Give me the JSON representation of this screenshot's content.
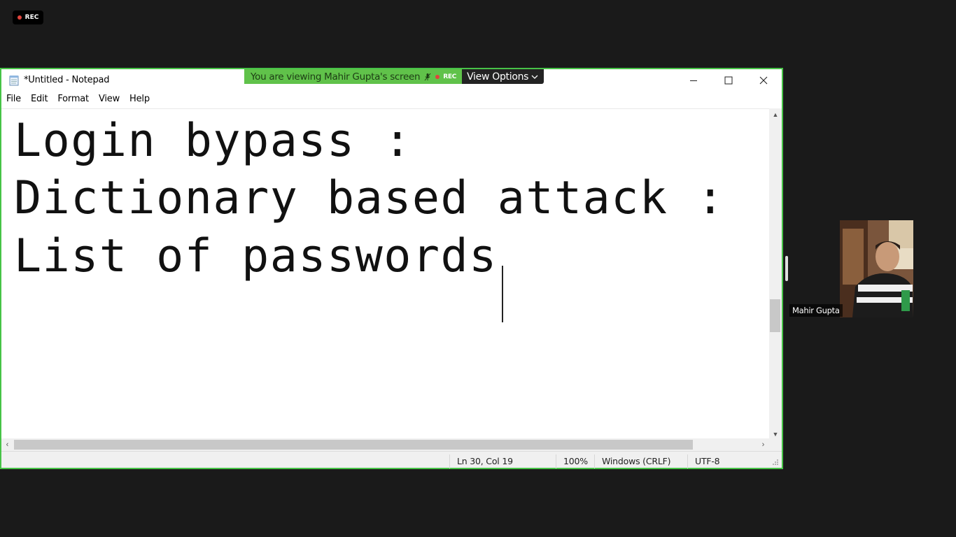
{
  "meeting": {
    "rec_label": "REC",
    "banner_text": "You are viewing Mahir Gupta's screen",
    "banner_rec": "REC",
    "view_options_label": "View Options",
    "participant_name": "Mahir Gupta",
    "accent_color": "#47c347"
  },
  "notepad": {
    "title": "*Untitled - Notepad",
    "menu": [
      "File",
      "Edit",
      "Format",
      "View",
      "Help"
    ],
    "lines": [
      "Login bypass :",
      "Dictionary based attack :",
      "List of passwords "
    ],
    "status": {
      "position": "Ln 30, Col 19",
      "zoom": "100%",
      "line_ending": "Windows (CRLF)",
      "encoding": "UTF-8"
    }
  },
  "icons": {
    "notepad": "notepad-icon",
    "minimize": "minimize-icon",
    "maximize": "maximize-icon",
    "close": "close-icon",
    "mic_off": "mic-off-icon",
    "chevron": "chevron-down-icon"
  }
}
